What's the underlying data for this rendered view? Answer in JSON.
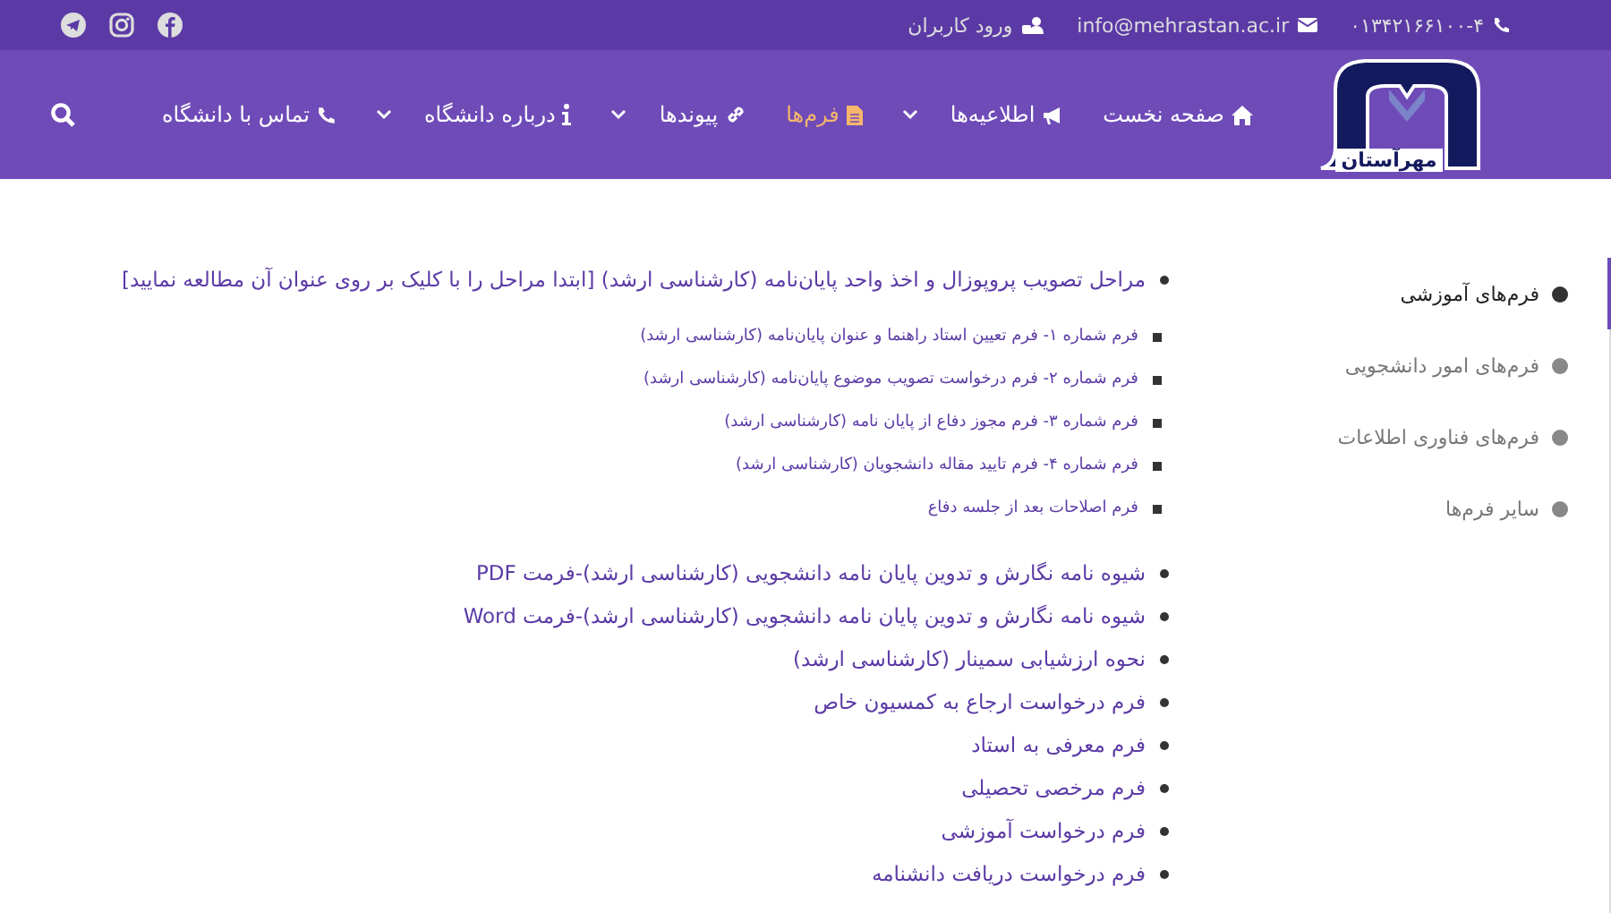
{
  "topbar": {
    "phone": "۰۱۳۴۲۱۶۶۱۰۰-۴",
    "email": "info@mehrastan.ac.ir",
    "login": "ورود کاربران",
    "social": [
      {
        "kind": "facebook"
      },
      {
        "kind": "instagram"
      },
      {
        "kind": "telegram"
      }
    ]
  },
  "logo": {
    "text": "مهرآستان"
  },
  "nav": [
    {
      "label": "صفحه نخست",
      "kind": "home",
      "dropdown": false,
      "selected": false
    },
    {
      "label": "اطلاعیه‌ها",
      "kind": "bullhorn",
      "dropdown": true,
      "selected": false
    },
    {
      "label": "فرم‌ها",
      "kind": "file",
      "dropdown": false,
      "selected": true
    },
    {
      "label": "پیوندها",
      "kind": "link",
      "dropdown": true,
      "selected": false
    },
    {
      "label": "درباره دانشگاه",
      "kind": "info",
      "dropdown": true,
      "selected": false
    },
    {
      "label": "تماس با دانشگاه",
      "kind": "phone",
      "dropdown": false,
      "selected": false
    }
  ],
  "sidebar": {
    "items": [
      {
        "label": "فرم‌های آموزشی",
        "selected": true
      },
      {
        "label": "فرم‌های امور دانشجویی",
        "selected": false
      },
      {
        "label": "فرم‌های فناوری اطلاعات",
        "selected": false
      },
      {
        "label": "سایر فرم‌ها",
        "selected": false
      }
    ]
  },
  "content": {
    "items": [
      {
        "text": "مراحل تصویب پروپوزال و اخذ واحد پایان‌نامه (کارشناسی ارشد) [ابتدا مراحل را با کلیک بر روی عنوان آن مطالعه نمایید]",
        "children": [
          {
            "text": "فرم شماره ۱- فرم تعیین استاد راهنما و عنوان پایان‌نامه (کارشناسی ارشد)"
          },
          {
            "text": "فرم شماره ۲- فرم درخواست تصویب موضوع پایان‌نامه (کارشناسی ارشد)"
          },
          {
            "text": "فرم شماره ۳- فرم مجوز دفاع از پایان نامه (کارشناسی ارشد)"
          },
          {
            "text": "فرم شماره ۴- فرم تایید مقاله دانشجویان (کارشناسی ارشد)"
          },
          {
            "text": "فرم اصلاحات بعد از جلسه دفاع"
          }
        ]
      },
      {
        "text": "شیوه نامه نگارش و تدوین پایان نامه دانشجویی (کارشناسی ارشد)-فرمت PDF"
      },
      {
        "text": "شیوه نامه نگارش و تدوین پایان نامه دانشجویی (کارشناسی ارشد)-فرمت Word"
      },
      {
        "text": "نحوه ارزشیابی سمینار (کارشناسی ارشد)"
      },
      {
        "text": "فرم درخواست ارجاع به کمسیون خاص"
      },
      {
        "text": "فرم معرفی به استاد"
      },
      {
        "text": "فرم مرخصی تحصیلی"
      },
      {
        "text": "فرم درخواست آموزشی"
      },
      {
        "text": "فرم درخواست دریافت دانشنامه"
      }
    ]
  }
}
